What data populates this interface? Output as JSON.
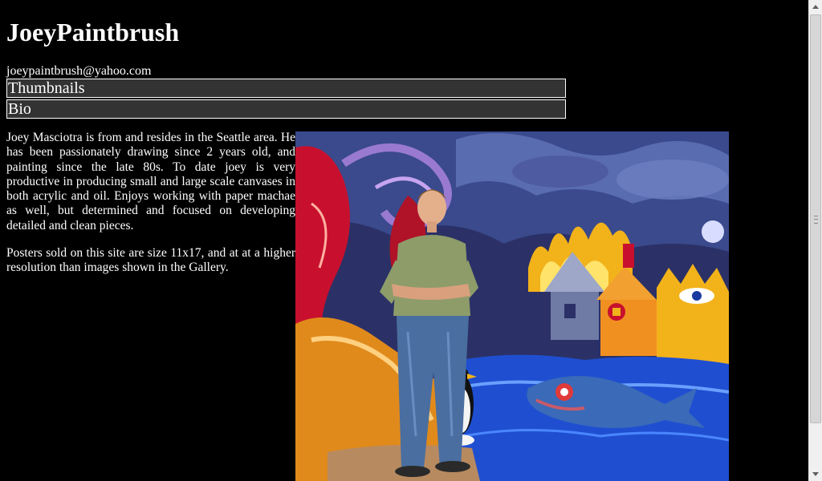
{
  "site": {
    "title": "JoeyPaintbrush",
    "email": "joeypaintbrush@yahoo.com"
  },
  "nav": {
    "items": [
      {
        "label": "Thumbnails"
      },
      {
        "label": "Bio"
      }
    ]
  },
  "bio": {
    "paragraphs": [
      "Joey Masciotra is from and resides in the Seattle area. He has been passionately drawing since 2 years old, and painting since the late 80s. To date joey is very productive in producing small and large scale canvases in both acrylic and oil. Enjoys working with paper machae as well, but determined and focused on developing detailed and clean pieces.",
      "Posters sold on this site are size 11x17, and at at a higher resolution than images shown in the Gallery."
    ]
  },
  "colors": {
    "background": "#000000",
    "nav_background": "#333333",
    "text": "#ffffff"
  },
  "icons": {
    "scroll_up": "triangle-up-icon",
    "scroll_down": "triangle-down-icon"
  }
}
